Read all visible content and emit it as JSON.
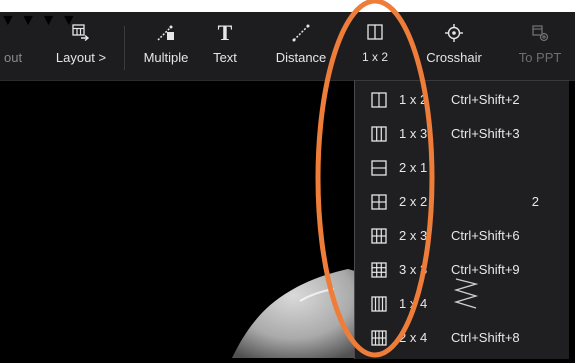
{
  "toolbar": {
    "buttons": [
      {
        "label": "out"
      },
      {
        "label": "Layout >"
      },
      {
        "label": "Multiple"
      },
      {
        "label": "Text"
      },
      {
        "label": "Distance"
      },
      {
        "label": "1 x 2"
      },
      {
        "label": "Crosshair"
      },
      {
        "label": "To PPT"
      }
    ],
    "text_icon_glyph": "T"
  },
  "menu": {
    "items": [
      {
        "label": "1 x 2",
        "shortcut": "Ctrl+Shift+2",
        "icon": "layout-1x2-icon"
      },
      {
        "label": "1 x 3",
        "shortcut": "Ctrl+Shift+3",
        "icon": "layout-1x3-icon"
      },
      {
        "label": "2 x 1",
        "shortcut": "",
        "icon": "layout-2x1-icon"
      },
      {
        "label": "2 x 2",
        "shortcut": "2",
        "icon": "layout-2x2-icon"
      },
      {
        "label": "2 x 3",
        "shortcut": "Ctrl+Shift+6",
        "icon": "layout-2x3-icon"
      },
      {
        "label": "3 x 3",
        "shortcut": "Ctrl+Shift+9",
        "icon": "layout-3x3-icon"
      },
      {
        "label": "1 x 4",
        "shortcut": "",
        "icon": "layout-1x4-icon"
      },
      {
        "label": "2 x 4",
        "shortcut": "Ctrl+Shift+8",
        "icon": "layout-2x4-icon"
      }
    ]
  },
  "colors": {
    "toolbar_bg": "#1d1d1f",
    "menu_bg": "#1f1f21",
    "text": "#e6e6e6",
    "annotation": "#ee7d3a"
  }
}
